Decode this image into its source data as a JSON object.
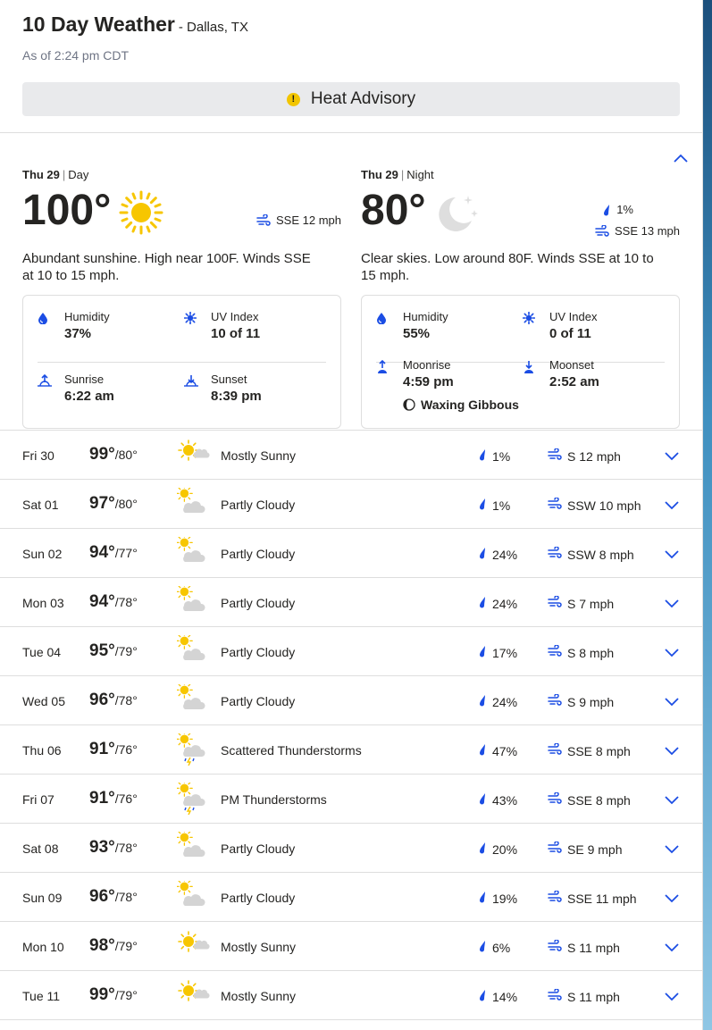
{
  "header": {
    "title": "10 Day Weather",
    "location": "- Dallas, TX",
    "as_of": "As of 2:24 pm CDT",
    "advisory": "Heat Advisory"
  },
  "today": {
    "day": {
      "date": "Thu 29",
      "label": "Day",
      "temp": "100°",
      "wind": "SSE 12 mph",
      "phrase": "Abundant sunshine. High near 100F. Winds SSE at 10 to 15 mph.",
      "humidity_label": "Humidity",
      "humidity": "37%",
      "uv_label": "UV Index",
      "uv": "10 of 11",
      "sunrise_label": "Sunrise",
      "sunrise": "6:22 am",
      "sunset_label": "Sunset",
      "sunset": "8:39 pm"
    },
    "night": {
      "date": "Thu 29",
      "label": "Night",
      "temp": "80°",
      "precip": "1%",
      "wind": "SSE 13 mph",
      "phrase": "Clear skies. Low around 80F. Winds SSE at 10 to 15 mph.",
      "humidity_label": "Humidity",
      "humidity": "55%",
      "uv_label": "UV Index",
      "uv": "0 of 11",
      "moonrise_label": "Moonrise",
      "moonrise": "4:59 pm",
      "moonset_label": "Moonset",
      "moonset": "2:52 am",
      "moon_phase": "Waxing Gibbous"
    }
  },
  "days": [
    {
      "date": "Fri 30",
      "hi": "99°",
      "lo": "/80°",
      "icon": "mostly-sunny",
      "phrase": "Mostly Sunny",
      "precip": "1%",
      "wind": "S 12 mph"
    },
    {
      "date": "Sat 01",
      "hi": "97°",
      "lo": "/80°",
      "icon": "partly-cloudy",
      "phrase": "Partly Cloudy",
      "precip": "1%",
      "wind": "SSW 10 mph"
    },
    {
      "date": "Sun 02",
      "hi": "94°",
      "lo": "/77°",
      "icon": "partly-cloudy",
      "phrase": "Partly Cloudy",
      "precip": "24%",
      "wind": "SSW 8 mph"
    },
    {
      "date": "Mon 03",
      "hi": "94°",
      "lo": "/78°",
      "icon": "partly-cloudy",
      "phrase": "Partly Cloudy",
      "precip": "24%",
      "wind": "S 7 mph"
    },
    {
      "date": "Tue 04",
      "hi": "95°",
      "lo": "/79°",
      "icon": "partly-cloudy",
      "phrase": "Partly Cloudy",
      "precip": "17%",
      "wind": "S 8 mph"
    },
    {
      "date": "Wed 05",
      "hi": "96°",
      "lo": "/78°",
      "icon": "partly-cloudy",
      "phrase": "Partly Cloudy",
      "precip": "24%",
      "wind": "S 9 mph"
    },
    {
      "date": "Thu 06",
      "hi": "91°",
      "lo": "/76°",
      "icon": "thunderstorm",
      "phrase": "Scattered Thunderstorms",
      "precip": "47%",
      "wind": "SSE 8 mph"
    },
    {
      "date": "Fri 07",
      "hi": "91°",
      "lo": "/76°",
      "icon": "thunderstorm",
      "phrase": "PM Thunderstorms",
      "precip": "43%",
      "wind": "SSE 8 mph"
    },
    {
      "date": "Sat 08",
      "hi": "93°",
      "lo": "/78°",
      "icon": "partly-cloudy",
      "phrase": "Partly Cloudy",
      "precip": "20%",
      "wind": "SE 9 mph"
    },
    {
      "date": "Sun 09",
      "hi": "96°",
      "lo": "/78°",
      "icon": "partly-cloudy",
      "phrase": "Partly Cloudy",
      "precip": "19%",
      "wind": "SSE 11 mph"
    },
    {
      "date": "Mon 10",
      "hi": "98°",
      "lo": "/79°",
      "icon": "mostly-sunny",
      "phrase": "Mostly Sunny",
      "precip": "6%",
      "wind": "S 11 mph"
    },
    {
      "date": "Tue 11",
      "hi": "99°",
      "lo": "/79°",
      "icon": "mostly-sunny",
      "phrase": "Mostly Sunny",
      "precip": "14%",
      "wind": "S 11 mph"
    }
  ],
  "colors": {
    "accent": "#1b4de4",
    "sun": "#f7c600",
    "cloud": "#d4d4d4",
    "advisory_bg": "#e9eaec",
    "advisory_icon": "#f2c500"
  }
}
